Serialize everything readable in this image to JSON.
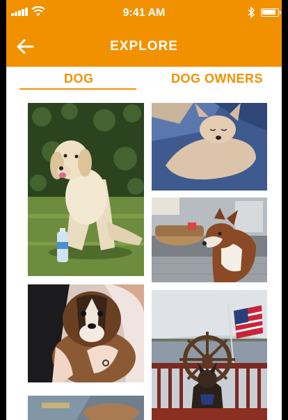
{
  "status_bar": {
    "time": "9:41 AM"
  },
  "header": {
    "title": "EXPLORE",
    "back_icon": "arrow-left-icon"
  },
  "tabs": [
    {
      "label": "DOG",
      "selected": true
    },
    {
      "label": "DOG OWNERS",
      "selected": false
    }
  ],
  "colors": {
    "accent": "#f29100",
    "background": "#ffffff"
  }
}
